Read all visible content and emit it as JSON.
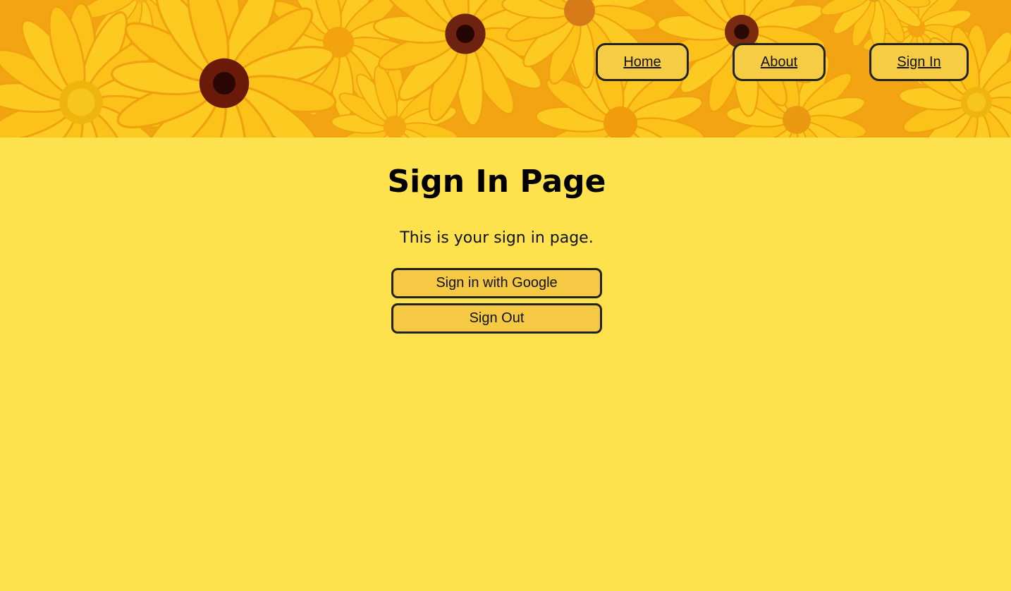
{
  "nav": {
    "home_label": "Home",
    "about_label": "About",
    "signin_label": "Sign In"
  },
  "main": {
    "title": "Sign In Page",
    "subtitle": "This is your sign in page.",
    "google_button_label": "Sign in with Google",
    "signout_button_label": "Sign Out"
  },
  "colors": {
    "page_background": "#fde24d",
    "button_background": "#f5c944",
    "button_border": "#222222",
    "banner_flower_petal": "#fcc419",
    "banner_flower_center": "#6b1a0a"
  },
  "icons": {
    "banner": "flower-banner-image"
  }
}
